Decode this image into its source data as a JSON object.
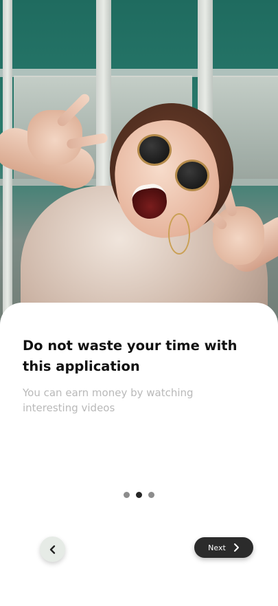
{
  "onboarding": {
    "title": "Do not waste your time with this application",
    "subtitle": "You can earn money by watching interesting videos",
    "pagination": {
      "total": 3,
      "active_index": 1
    },
    "back_button": {
      "icon": "chevron-left-icon"
    },
    "next_button": {
      "label": "Next",
      "icon": "chevron-right-icon"
    }
  },
  "colors": {
    "title": "#111111",
    "subtitle": "#b9b9b9",
    "dot_inactive": "#8c8c8c",
    "dot_active": "#262626",
    "next_button_bg": "#2b2b2b",
    "back_button_bg": "#e6ebe6"
  }
}
